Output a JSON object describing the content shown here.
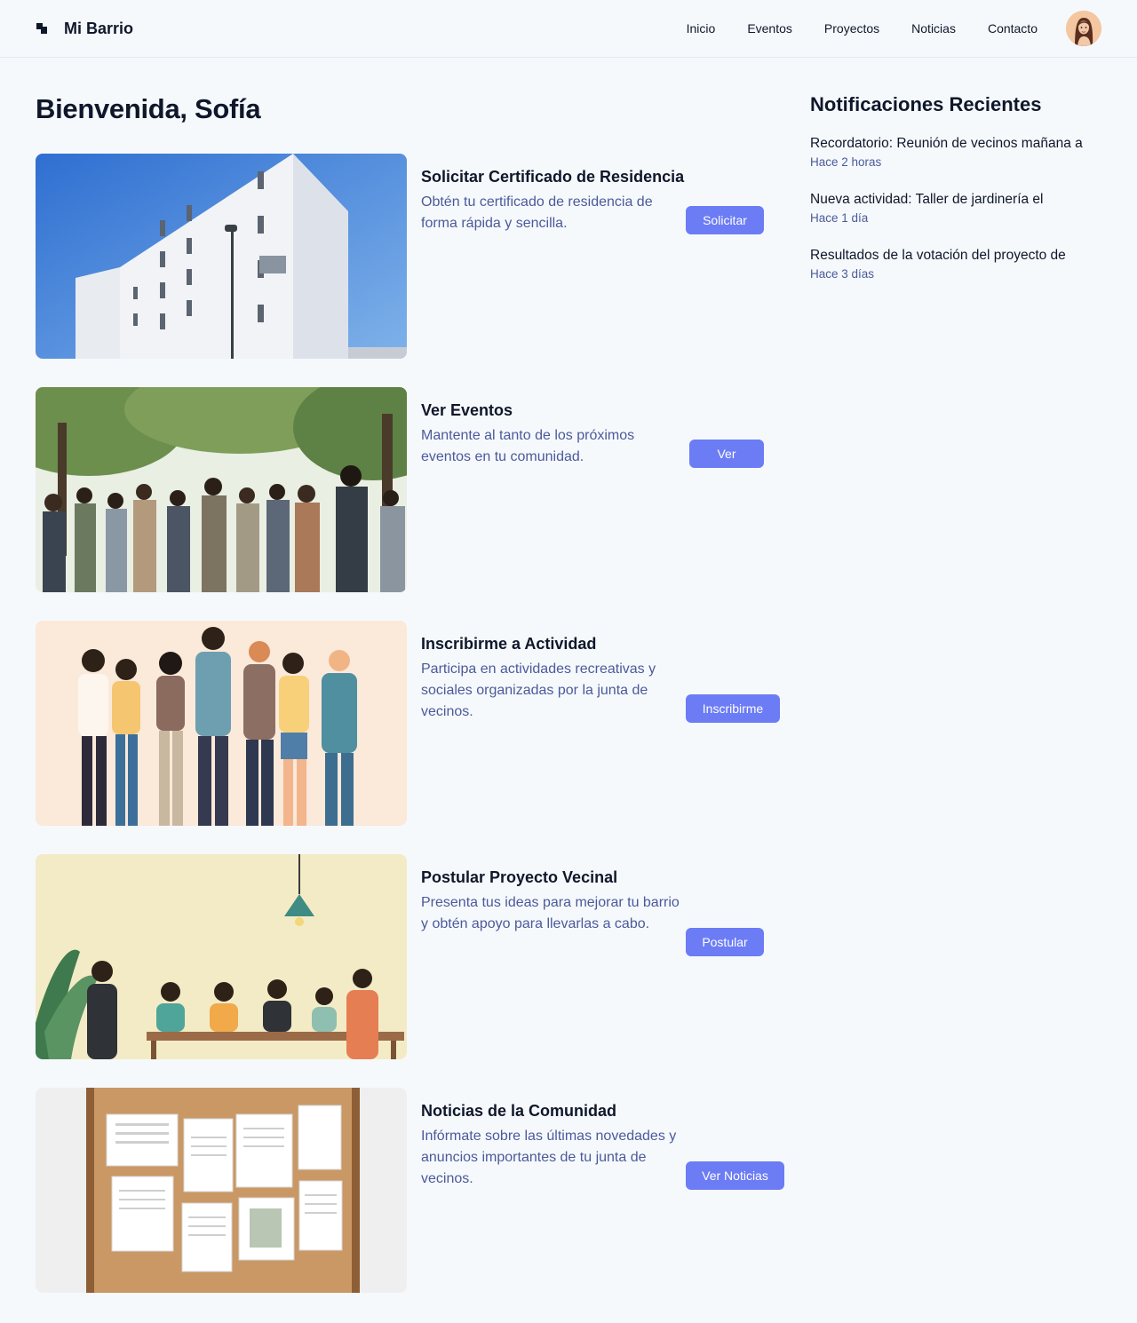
{
  "header": {
    "brand": "Mi Barrio",
    "nav": [
      "Inicio",
      "Eventos",
      "Proyectos",
      "Noticias",
      "Contacto"
    ]
  },
  "page": {
    "title": "Bienvenida, Sofía"
  },
  "cards": [
    {
      "title": "Solicitar Certificado de Residencia",
      "description": "Obtén tu certificado de residencia de forma rápida y sencilla.",
      "button": "Solicitar",
      "image": "apartment-building"
    },
    {
      "title": "Ver Eventos",
      "description": "Mantente al tanto de los próximos eventos en tu comunidad.",
      "button": "Ver",
      "image": "crowd-in-park"
    },
    {
      "title": "Inscribirme a Actividad",
      "description": "Participa en actividades recreativas y sociales organizadas por la junta de vecinos.",
      "button": "Inscribirme",
      "image": "group-of-people-illustration"
    },
    {
      "title": "Postular Proyecto Vecinal",
      "description": "Presenta tus ideas para mejorar tu barrio y obtén apoyo para llevarlas a cabo.",
      "button": "Postular",
      "image": "meeting-table-illustration"
    },
    {
      "title": "Noticias de la Comunidad",
      "description": "Infórmate sobre las últimas novedades y anuncios importantes de tu junta de vecinos.",
      "button": "Ver Noticias",
      "image": "bulletin-board"
    }
  ],
  "notifications": {
    "title": "Notificaciones Recientes",
    "items": [
      {
        "text": "Recordatorio: Reunión de vecinos mañana a",
        "time": "Hace 2 horas"
      },
      {
        "text": "Nueva actividad: Taller de jardinería el",
        "time": "Hace 1 día"
      },
      {
        "text": "Resultados de la votación del proyecto de",
        "time": "Hace 3 días"
      }
    ]
  },
  "colors": {
    "accent": "#6b7cf5",
    "secondary_text": "#4b5a9a",
    "background": "#f6f9fc"
  }
}
